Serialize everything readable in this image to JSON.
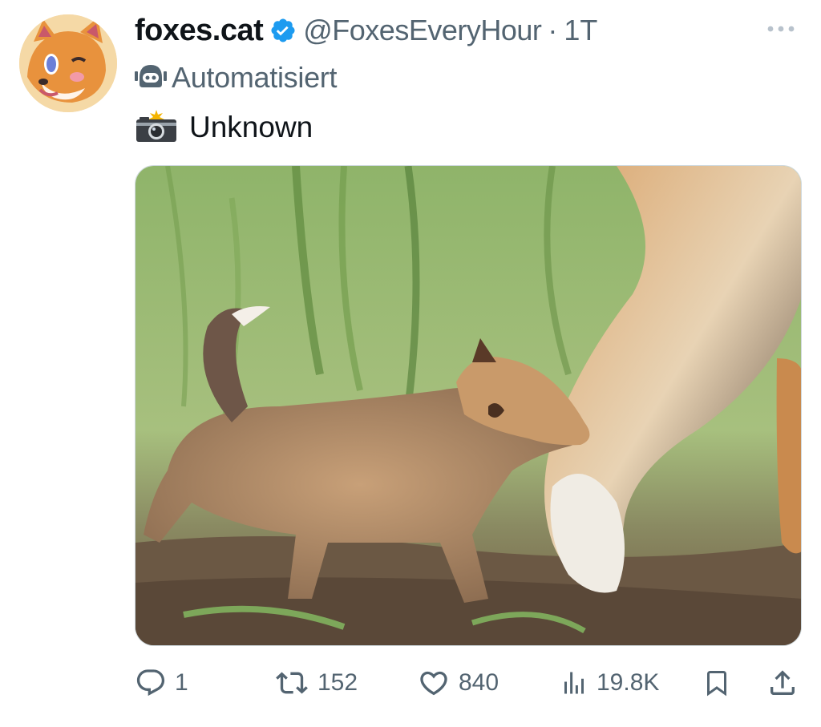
{
  "tweet": {
    "display_name": "foxes.cat",
    "handle": "@FoxesEveryHour",
    "separator": "·",
    "time": "1T",
    "automated_label": "Automatisiert",
    "text": "Unknown",
    "text_emoji": "camera-flash-icon"
  },
  "icons": {
    "verified": "verified-badge-icon",
    "more": "more-icon",
    "automated": "robot-icon",
    "reply": "reply-icon",
    "retweet": "retweet-icon",
    "like": "like-icon",
    "views": "views-icon",
    "bookmark": "bookmark-icon",
    "share": "share-icon"
  },
  "colors": {
    "verified": "#1d9bf0",
    "secondary_text": "#536471",
    "primary_text": "#0f1419"
  },
  "actions": {
    "reply_count": "1",
    "retweet_count": "152",
    "like_count": "840",
    "views_count": "19.8K"
  }
}
